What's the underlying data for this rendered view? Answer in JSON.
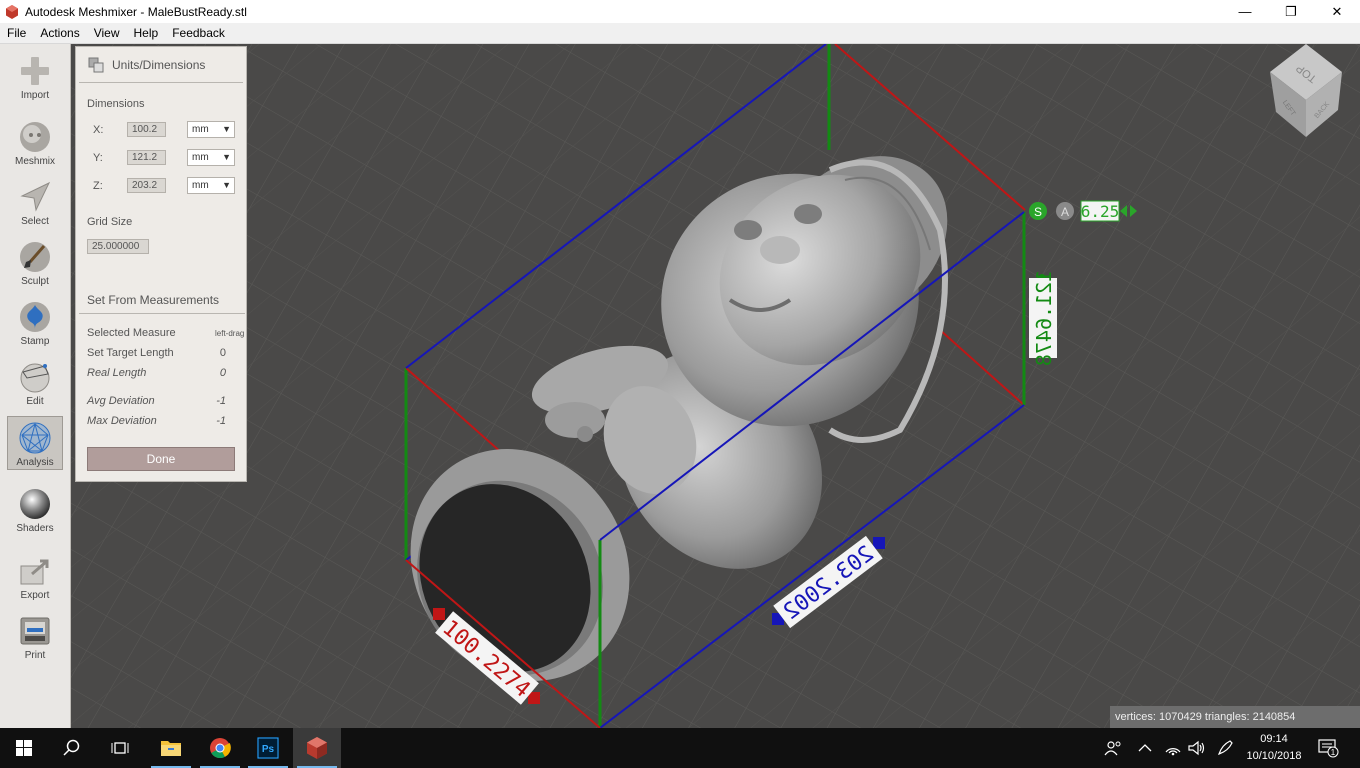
{
  "window": {
    "title": "Autodesk Meshmixer - MaleBustReady.stl",
    "minimize": "—",
    "maximize": "❐",
    "close": "✕"
  },
  "menu": [
    "File",
    "Actions",
    "View",
    "Help",
    "Feedback"
  ],
  "toolbar": [
    {
      "label": "Import",
      "icon": "plus-icon"
    },
    {
      "label": "Meshmix",
      "icon": "meshmix-icon"
    },
    {
      "label": "Select",
      "icon": "select-arrow-icon"
    },
    {
      "label": "Sculpt",
      "icon": "brush-icon"
    },
    {
      "label": "Stamp",
      "icon": "stamp-icon"
    },
    {
      "label": "Edit",
      "icon": "edit-sphere-icon"
    },
    {
      "label": "Analysis",
      "icon": "analysis-sphere-icon",
      "active": true
    },
    {
      "label": "Shaders",
      "icon": "shaders-sphere-icon"
    },
    {
      "label": "Export",
      "icon": "export-icon"
    },
    {
      "label": "Print",
      "icon": "printer-icon"
    }
  ],
  "panel": {
    "title": "Units/Dimensions",
    "dimensions_label": "Dimensions",
    "x_label": "X:",
    "x_value": "100.2",
    "x_unit": "mm",
    "y_label": "Y:",
    "y_value": "121.2",
    "y_unit": "mm",
    "z_label": "Z:",
    "z_value": "203.2",
    "z_unit": "mm",
    "grid_size_label": "Grid Size",
    "grid_size_value": "25.000000",
    "set_from_label": "Set From Measurements",
    "selected_measure_label": "Selected Measure",
    "selected_measure_hint": "left-drag",
    "set_target_length_label": "Set Target Length",
    "set_target_length_value": "0",
    "real_length_label": "Real Length",
    "real_length_value": "0",
    "avg_deviation_label": "Avg Deviation",
    "avg_deviation_value": "-1",
    "max_deviation_label": "Max Deviation",
    "max_deviation_value": "-1",
    "done_label": "Done"
  },
  "viewport": {
    "snap_label": "S",
    "abs_label": "A",
    "scale_value": "6.25",
    "dim_x": "100.2274",
    "dim_y": "203.2002",
    "dim_z": "121.6478",
    "viewcube_top": "TOP",
    "viewcube_back": "BACK",
    "viewcube_left": "LEFT"
  },
  "status": "vertices: 1070429 triangles: 2140854",
  "clock": {
    "time": "09:14",
    "date": "10/10/2018"
  },
  "notification_count": "1",
  "colors": {
    "x_axis": "#c01616",
    "y_axis": "#1616b8",
    "z_axis": "#138a13",
    "background": "#4a4948"
  }
}
